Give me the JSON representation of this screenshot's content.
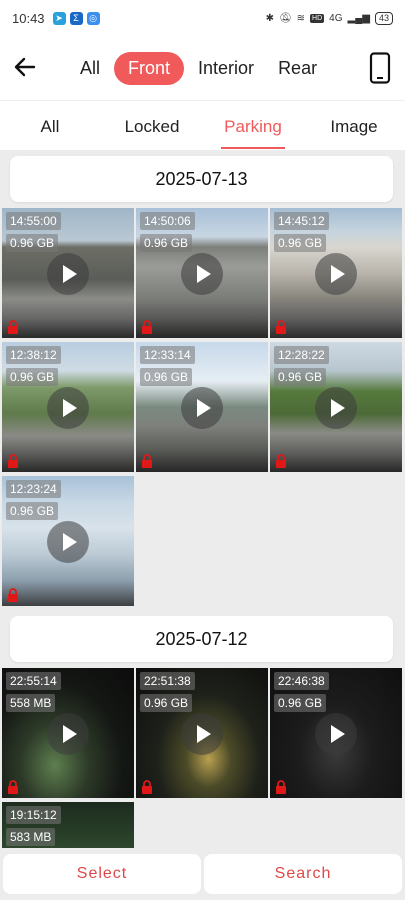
{
  "status_bar": {
    "time": "10:43",
    "network": "4G",
    "hd_label": "HD",
    "battery": "43"
  },
  "top_nav": {
    "camera_tabs": [
      {
        "label": "All",
        "active": false
      },
      {
        "label": "Front",
        "active": true
      },
      {
        "label": "Interior",
        "active": false
      },
      {
        "label": "Rear",
        "active": false
      }
    ]
  },
  "category_tabs": [
    {
      "label": "All",
      "active": false
    },
    {
      "label": "Locked",
      "active": false
    },
    {
      "label": "Parking",
      "active": true
    },
    {
      "label": "Image",
      "active": false
    }
  ],
  "groups": [
    {
      "date": "2025-07-13",
      "items": [
        {
          "time": "14:55:00",
          "size": "0.96 GB",
          "scene": "day-bridge",
          "locked": true
        },
        {
          "time": "14:50:06",
          "size": "0.96 GB",
          "scene": "day-overpass",
          "locked": true
        },
        {
          "time": "14:45:12",
          "size": "0.96 GB",
          "scene": "day-building",
          "locked": true
        },
        {
          "time": "12:38:12",
          "size": "0.96 GB",
          "scene": "day-truck",
          "locked": true
        },
        {
          "time": "12:33:14",
          "size": "0.96 GB",
          "scene": "day-arch",
          "locked": true
        },
        {
          "time": "12:28:22",
          "size": "0.96 GB",
          "scene": "day-trees",
          "locked": true
        },
        {
          "time": "12:23:24",
          "size": "0.96 GB",
          "scene": "day-blur",
          "locked": true
        }
      ]
    },
    {
      "date": "2025-07-12",
      "items": [
        {
          "time": "22:55:14",
          "size": "558 MB",
          "scene": "night-1",
          "locked": true
        },
        {
          "time": "22:51:38",
          "size": "0.96 GB",
          "scene": "night-2",
          "locked": true
        },
        {
          "time": "22:46:38",
          "size": "0.96 GB",
          "scene": "night-3",
          "locked": true
        },
        {
          "time": "19:15:12",
          "size": "583 MB",
          "scene": "dusk",
          "locked": false
        }
      ]
    }
  ],
  "bottom": {
    "select_label": "Select",
    "search_label": "Search"
  },
  "colors": {
    "accent": "#f05a5a",
    "lock": "#e01818"
  }
}
